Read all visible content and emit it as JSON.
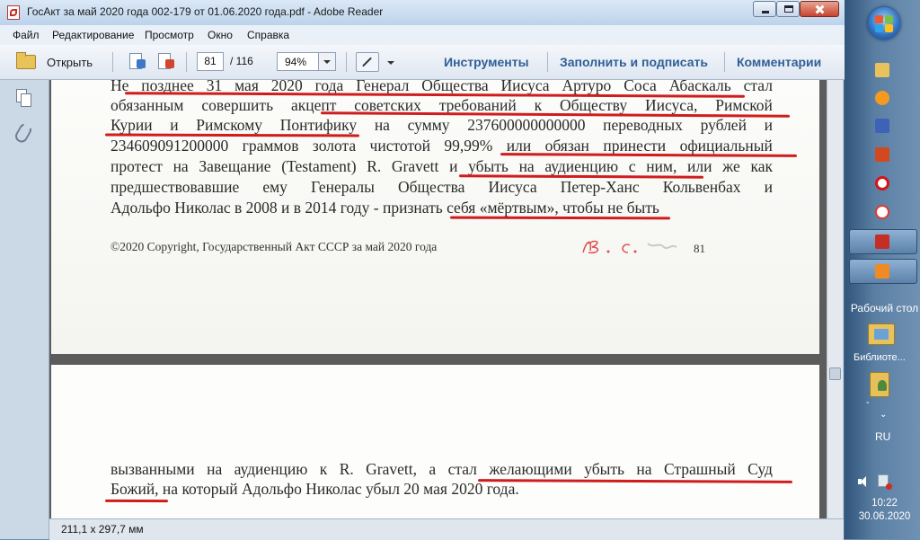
{
  "window": {
    "title": "ГосАкт за май 2020 года 002-179 от 01.06.2020 года.pdf - Adobe Reader"
  },
  "menu": [
    "Файл",
    "Редактирование",
    "Просмотр",
    "Окно",
    "Справка"
  ],
  "toolbar": {
    "open_label": "Открыть",
    "current_page": "81",
    "total_pages": "/ 116",
    "zoom": "94%",
    "tools_label": "Инструменты",
    "fill_sign_label": "Заполнить и подписать",
    "comments_label": "Комментарии"
  },
  "document": {
    "page1_lines": [
      [
        "Не",
        "позднее",
        "31",
        "мая",
        "2020",
        "года",
        "Генерал",
        "Общества",
        "Иисуса",
        "Артуро",
        "Соса",
        "Абаскаль",
        "стал"
      ],
      [
        "обязанным",
        "совершить",
        "акцепт",
        "советских",
        "требований",
        "к",
        "Обществу",
        "Иисуса,",
        "Римской"
      ],
      [
        "Курии",
        "и",
        "Римскому",
        "Понтифику",
        "на",
        "сумму",
        "237600000000000",
        "переводных",
        "рублей",
        "и"
      ],
      [
        "234609091200000",
        "граммов",
        "золота",
        "чистотой",
        "99,99%",
        "или",
        "обязан",
        "принести",
        "официальный"
      ],
      [
        "протест",
        "на",
        "Завещание",
        "(Testament)",
        "R.",
        "Gravett",
        "и",
        "убыть",
        "на",
        "аудиенцию",
        "с",
        "ним,",
        "или",
        "же",
        "как"
      ],
      [
        "предшествовавшие",
        "ему",
        "Генералы",
        "Общества",
        "Иисуса",
        "Петер-Ханс",
        "Кольвенбах",
        "и"
      ],
      [
        "Адольфо Николас в 2008 и в 2014 году - признать себя «мёртвым», чтобы не быть"
      ]
    ],
    "copyright": "©2020 Copyright, Государственный Акт СССР за май 2020 года",
    "page_number": "81",
    "signature": "R. C.",
    "page2_lines": [
      [
        "вызванными",
        "на",
        "аудиенцию",
        "к",
        "R.",
        "Gravett,",
        "а",
        "стал",
        "желающими",
        "убыть",
        "на",
        "Страшный",
        "Суд"
      ],
      [
        "Божий, на который Адольфо Николас убыл 20 мая 2020 года."
      ]
    ]
  },
  "status": {
    "page_size": "211,1 x 297,7 мм"
  },
  "taskbar": {
    "desktop_label": "Рабочий стол",
    "library_label": "Библиоте...",
    "dash": "-",
    "language": "RU",
    "time": "10:22",
    "date": "30.06.2020"
  },
  "colors": {
    "underline": "#cf1d1d",
    "link": "#2f5f96"
  }
}
